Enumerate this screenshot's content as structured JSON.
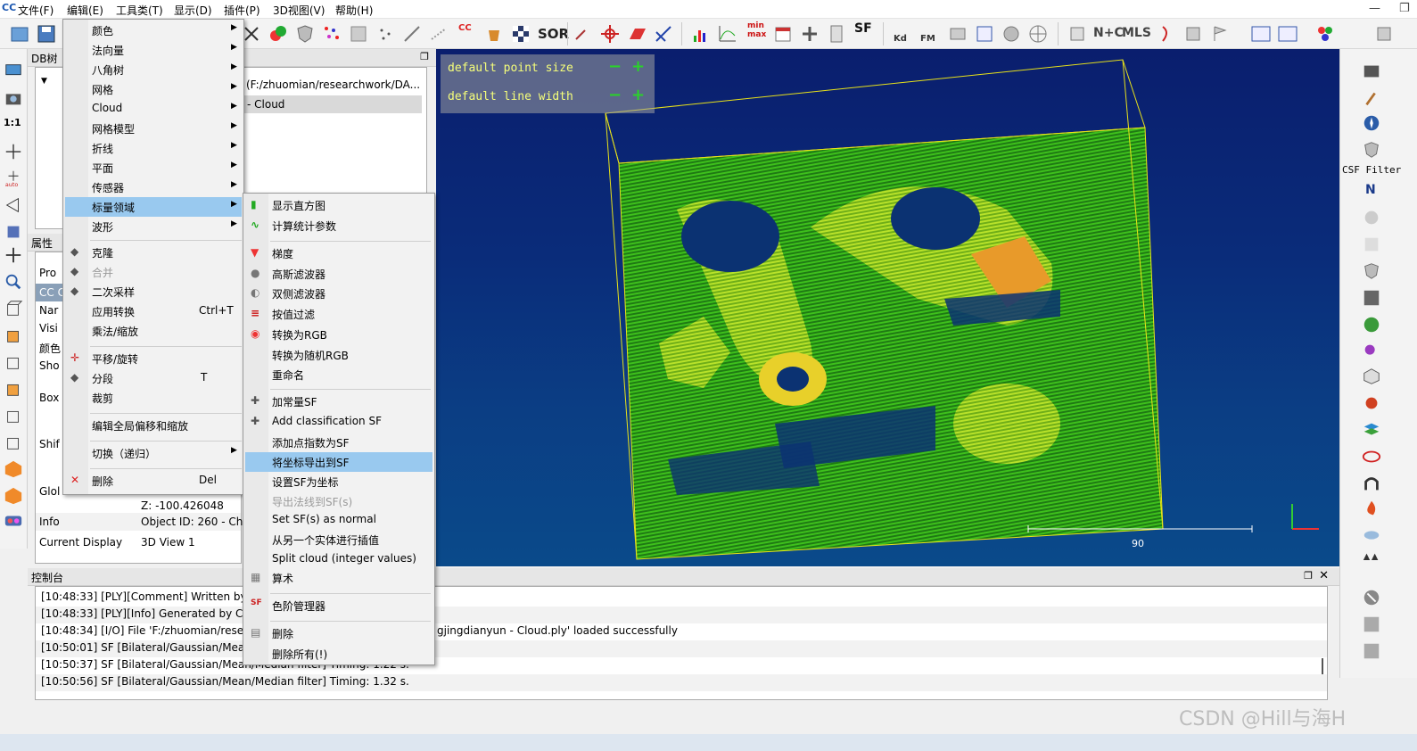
{
  "menubar": {
    "items": [
      "文件(F)",
      "编辑(E)",
      "工具类(T)",
      "显示(D)",
      "插件(P)",
      "3D视图(V)",
      "帮助(H)"
    ]
  },
  "toolbar": {
    "sor_label": "SOR",
    "sf_label": "SF",
    "kd_label": "Kd",
    "fm_label": "FM",
    "nc_label": "N+C",
    "mls_label": "MLS",
    "cc_label": "CC"
  },
  "dbtree": {
    "title": "DB树",
    "path": "(F:/zhuomian/researchwork/DA...",
    "item": "- Cloud"
  },
  "properties": {
    "title": "属性",
    "rows": [
      "Pro",
      "CC C",
      "Nar",
      "Visi",
      "颜色",
      "Sho",
      "Box",
      "Shif",
      "Glol"
    ],
    "z_value": "Z: -100.426048",
    "info_label": "Info",
    "info_value": "Object ID: 260 - Ch",
    "display_label": "Current Display",
    "display_value": "3D View 1"
  },
  "view3d": {
    "point_size_label": "default point size",
    "line_width_label": "default line width",
    "scale_value": "90"
  },
  "right_toolbar": {
    "csf_label": "CSF Filter",
    "north_label": "N"
  },
  "console": {
    "title": "控制台",
    "lines": [
      "[10:48:33] [PLY][Comment] Written by F",
      "[10:48:33] [PLY][Info] Generated by Clo",
      "[10:48:34] [I/O] File 'F:/zhuomian/resear",
      "[10:50:01] SF [Bilateral/Gaussian/Mean/",
      "[10:50:37] SF [Bilateral/Gaussian/Mean/Median filter] Timing: 1.22 s.",
      "[10:50:56] SF [Bilateral/Gaussian/Mean/Median filter] Timing: 1.32 s."
    ],
    "line3_tail": "gjingdianyun - Cloud.ply' loaded successfully"
  },
  "edit_menu": {
    "items": [
      {
        "label": "颜色",
        "arrow": true
      },
      {
        "label": "法向量",
        "arrow": true
      },
      {
        "label": "八角树",
        "arrow": true
      },
      {
        "label": "网格",
        "arrow": true
      },
      {
        "label": "Cloud",
        "arrow": true
      },
      {
        "label": "网格模型",
        "arrow": true
      },
      {
        "label": "折线",
        "arrow": true
      },
      {
        "label": "平面",
        "arrow": true
      },
      {
        "label": "传感器",
        "arrow": true
      },
      {
        "label": "标量领域",
        "arrow": true,
        "highlight": true
      },
      {
        "label": "波形",
        "arrow": true
      },
      {
        "label": "克隆"
      },
      {
        "label": "合并",
        "disabled": true
      },
      {
        "label": "二次采样"
      },
      {
        "label": "应用转换",
        "shortcut": "Ctrl+T"
      },
      {
        "label": "乘法/缩放"
      },
      {
        "label": "平移/旋转"
      },
      {
        "label": "分段",
        "shortcut": "T"
      },
      {
        "label": "裁剪"
      },
      {
        "label": "编辑全局偏移和缩放"
      },
      {
        "label": "切换（递归）",
        "arrow": true
      },
      {
        "label": "删除",
        "shortcut": "Del"
      }
    ]
  },
  "sf_submenu": {
    "items": [
      {
        "label": "显示直方图"
      },
      {
        "label": "计算统计参数"
      },
      {
        "label": "梯度"
      },
      {
        "label": "高斯滤波器"
      },
      {
        "label": "双侧滤波器"
      },
      {
        "label": "按值过滤"
      },
      {
        "label": "转换为RGB"
      },
      {
        "label": "转换为随机RGB"
      },
      {
        "label": "重命名"
      },
      {
        "label": "加常量SF"
      },
      {
        "label": "Add classification SF"
      },
      {
        "label": "添加点指数为SF"
      },
      {
        "label": "将坐标导出到SF",
        "highlight": true
      },
      {
        "label": "设置SF为坐标"
      },
      {
        "label": "导出法线到SF(s)",
        "disabled": true
      },
      {
        "label": "Set SF(s) as normal"
      },
      {
        "label": "从另一个实体进行插值"
      },
      {
        "label": "Split cloud (integer values)"
      },
      {
        "label": "算术"
      },
      {
        "label": "色阶管理器"
      },
      {
        "label": "删除"
      },
      {
        "label": "删除所有(!)"
      }
    ]
  },
  "watermark": "CSDN @Hill与海H",
  "colors": {
    "menu_highlight": "#99c9ef",
    "view_bg_top": "#0a1e6e",
    "view_bg_bottom": "#0a4a8a",
    "cloud_green": "#3ec01c",
    "cloud_yellow": "#d7e82a",
    "box_yellow": "#e8e21a"
  }
}
